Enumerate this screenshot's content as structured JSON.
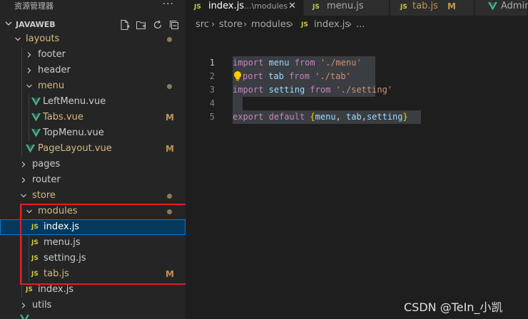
{
  "sidebar": {
    "title": "资源管理器",
    "more": "···",
    "project": "JAVAWEB",
    "tree": {
      "layouts": "layouts",
      "footer": "footer",
      "header": "header",
      "menu": "menu",
      "left_menu": "LeftMenu.vue",
      "tabs_vue": "Tabs.vue",
      "top_menu": "TopMenu.vue",
      "page_layout": "PageLayout.vue",
      "pages": "pages",
      "router": "router",
      "store": "store",
      "modules": "modules",
      "index_js": "index.js",
      "menu_js": "menu.js",
      "setting_js": "setting.js",
      "tab_js": "tab.js",
      "store_index_js": "index.js",
      "utils": "utils"
    },
    "badge_modified": "M",
    "file_icon_js": "JS"
  },
  "tabs": [
    {
      "name": "index.js",
      "desc": "...\\modules",
      "close": "✕"
    },
    {
      "name": "menu.js"
    },
    {
      "name": "tab.js",
      "badge": "M"
    },
    {
      "name": "AdminH"
    }
  ],
  "breadcrumb": [
    "src",
    "store",
    "modules",
    "index.js",
    "..."
  ],
  "code": {
    "line_numbers": [
      "1",
      "2",
      "3",
      "4",
      "5"
    ],
    "lines": [
      {
        "kw1": "import",
        "id": "menu",
        "kw2": "from",
        "str": "'./menu'"
      },
      {
        "kw1": "port",
        "id": "tab",
        "kw2": "from",
        "str": "'./tab'"
      },
      {
        "kw1": "import",
        "id": "setting",
        "kw2": "from",
        "str": "'./setting'"
      },
      {},
      {
        "kw1": "export",
        "kw2": "default",
        "open": "{",
        "a": "menu",
        "c1": ",",
        "b": "tab",
        "c2": ",",
        "c": "setting",
        "close": "}"
      }
    ]
  },
  "watermark": "CSDN @TeIn_小凯"
}
